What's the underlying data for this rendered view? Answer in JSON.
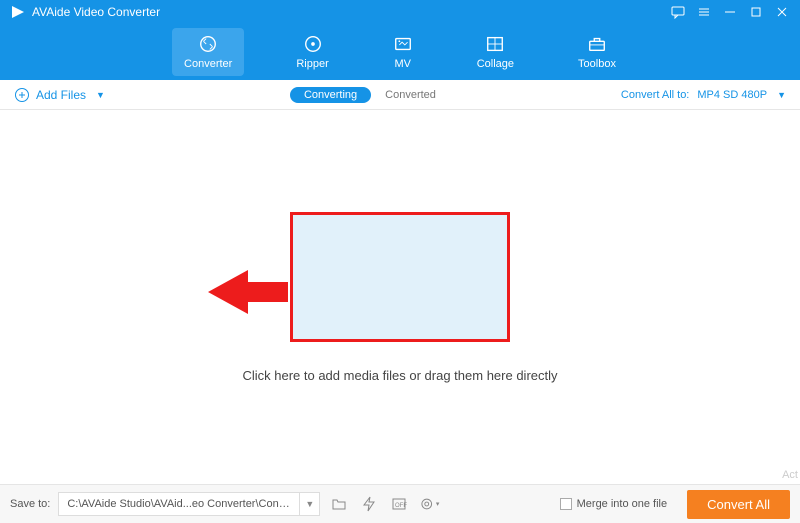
{
  "titlebar": {
    "app_name": "AVAide Video Converter"
  },
  "nav": {
    "items": [
      {
        "label": "Converter"
      },
      {
        "label": "Ripper"
      },
      {
        "label": "MV"
      },
      {
        "label": "Collage"
      },
      {
        "label": "Toolbox"
      }
    ]
  },
  "subbar": {
    "add_files_label": "Add Files",
    "tab_converting": "Converting",
    "tab_converted": "Converted",
    "convert_all_label": "Convert All to:",
    "format_selected": "MP4 SD 480P"
  },
  "main": {
    "hint": "Click here to add media files or drag them here directly"
  },
  "footer": {
    "save_to_label": "Save to:",
    "save_path": "C:\\AVAide Studio\\AVAid...eo Converter\\Converted",
    "merge_label": "Merge into one file",
    "convert_button": "Convert All"
  },
  "watermark": "Act"
}
